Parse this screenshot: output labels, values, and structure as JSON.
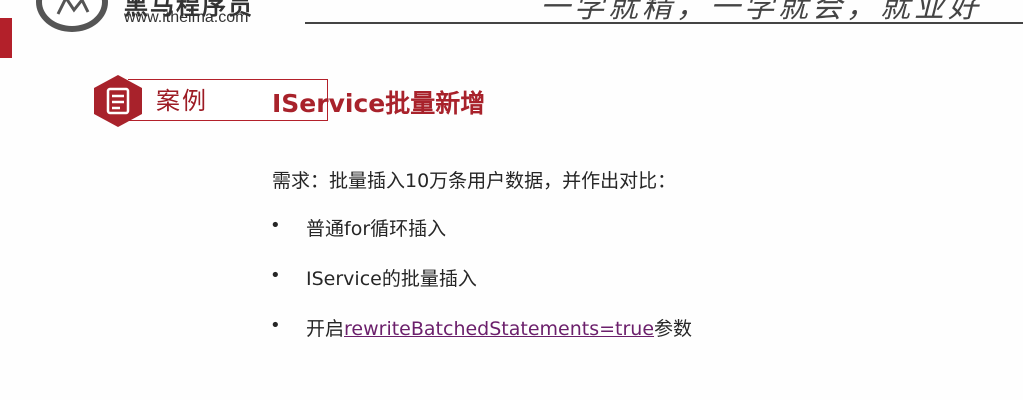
{
  "header": {
    "brand_name": "黑马程序员",
    "brand_url": "www.itheima.com",
    "slogan": "一学就精，一学就会，就业好"
  },
  "case_badge": {
    "label": "案例",
    "icon": "document-icon"
  },
  "title": "IService批量新增",
  "requirement": "需求：批量插入10万条用户数据，并作出对比：",
  "bullets": [
    {
      "text": "普通for循环插入"
    },
    {
      "text": "IService的批量插入"
    },
    {
      "prefix": "开启",
      "link": "rewriteBatchedStatements=true",
      "suffix": "参数"
    }
  ],
  "colors": {
    "accent": "#b3202a",
    "link": "#6b1f6b"
  }
}
